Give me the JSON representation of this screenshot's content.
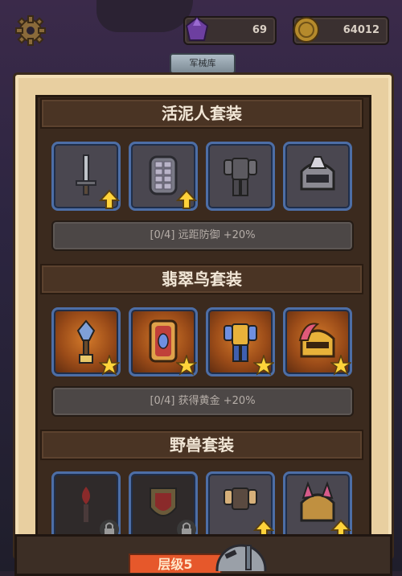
{
  "resources": {
    "gems": "69",
    "gold": "64012"
  },
  "title_tab": "军械库",
  "sets": [
    {
      "name": "活泥人套装",
      "bonus": "[0/4] 远距防御 +20%",
      "items": [
        "sword-icon",
        "shield-icon",
        "armor-icon",
        "helmet-icon"
      ],
      "badges": [
        "upgrade-arrow-icon",
        "upgrade-arrow-icon",
        "",
        ""
      ]
    },
    {
      "name": "翡翠鸟套装",
      "bonus": "[0/4] 获得黄金 +20%",
      "items": [
        "axe-icon",
        "shield-icon",
        "armor-icon",
        "helmet-icon"
      ],
      "badges": [
        "star-icon",
        "star-icon",
        "star-icon",
        "star-icon"
      ]
    },
    {
      "name": "野兽套装",
      "bonus": "",
      "items": [
        "torch-icon",
        "shield-icon",
        "armor-icon",
        "helmet-icon"
      ],
      "badges": [
        "lock-icon",
        "lock-icon",
        "upgrade-arrow-icon",
        "upgrade-arrow-icon"
      ]
    }
  ],
  "footer": {
    "level_label": "层级5"
  },
  "colors": {
    "panel": "#e8cfa0",
    "inner": "#3b2a1e",
    "slot_border": "#4d6ea6",
    "level_button": "#e6582b"
  }
}
